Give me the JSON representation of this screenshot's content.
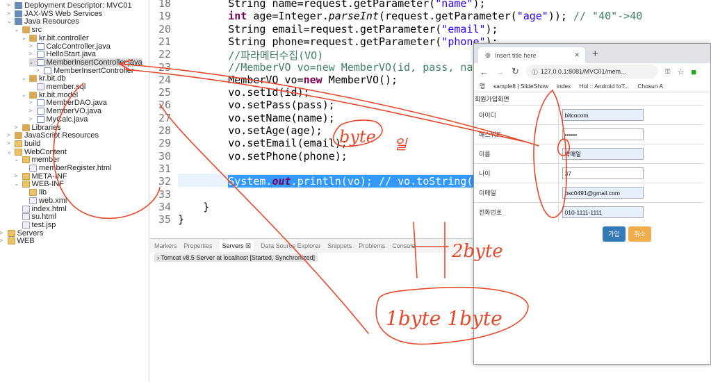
{
  "explorer": {
    "items": [
      {
        "label": "Deployment Descriptor: MVC01",
        "depth": 0,
        "arrow": ">",
        "icon": "proj"
      },
      {
        "label": "JAX-WS Web Services",
        "depth": 0,
        "arrow": ">",
        "icon": "proj"
      },
      {
        "label": "Java Resources",
        "depth": 0,
        "arrow": "v",
        "icon": "proj"
      },
      {
        "label": "src",
        "depth": 1,
        "arrow": "v",
        "icon": "pkg"
      },
      {
        "label": "kr.bit.controller",
        "depth": 2,
        "arrow": "v",
        "icon": "pkg"
      },
      {
        "label": "CalcController.java",
        "depth": 3,
        "arrow": ">",
        "icon": "java"
      },
      {
        "label": "HelloStart.java",
        "depth": 3,
        "arrow": ">",
        "icon": "java"
      },
      {
        "label": "MemberInsertController.java",
        "depth": 3,
        "arrow": "v",
        "icon": "java",
        "selected": true
      },
      {
        "label": "MemberInsertController",
        "depth": 4,
        "arrow": ">",
        "icon": "java"
      },
      {
        "label": "kr.bit.db",
        "depth": 2,
        "arrow": "v",
        "icon": "pkg"
      },
      {
        "label": "member.sql",
        "depth": 3,
        "arrow": "",
        "icon": "file"
      },
      {
        "label": "kr.bit.model",
        "depth": 2,
        "arrow": "v",
        "icon": "pkg"
      },
      {
        "label": "MemberDAO.java",
        "depth": 3,
        "arrow": ">",
        "icon": "java"
      },
      {
        "label": "MemberVO.java",
        "depth": 3,
        "arrow": ">",
        "icon": "java"
      },
      {
        "label": "MyCalc.java",
        "depth": 3,
        "arrow": ">",
        "icon": "java"
      },
      {
        "label": "Libraries",
        "depth": 1,
        "arrow": ">",
        "icon": "pkg"
      },
      {
        "label": "JavaScript Resources",
        "depth": 0,
        "arrow": ">",
        "icon": "pkg"
      },
      {
        "label": "build",
        "depth": 0,
        "arrow": ">",
        "icon": "folder"
      },
      {
        "label": "WebContent",
        "depth": 0,
        "arrow": "v",
        "icon": "folder"
      },
      {
        "label": "member",
        "depth": 1,
        "arrow": "v",
        "icon": "folder"
      },
      {
        "label": "memberRegister.html",
        "depth": 2,
        "arrow": "",
        "icon": "file"
      },
      {
        "label": "META-INF",
        "depth": 1,
        "arrow": ">",
        "icon": "folder"
      },
      {
        "label": "WEB-INF",
        "depth": 1,
        "arrow": "v",
        "icon": "folder"
      },
      {
        "label": "lib",
        "depth": 2,
        "arrow": "",
        "icon": "folder"
      },
      {
        "label": "web.xml",
        "depth": 2,
        "arrow": "",
        "icon": "file"
      },
      {
        "label": "index.html",
        "depth": 1,
        "arrow": "",
        "icon": "file"
      },
      {
        "label": "su.html",
        "depth": 1,
        "arrow": "",
        "icon": "file"
      },
      {
        "label": "test.jsp",
        "depth": 1,
        "arrow": "",
        "icon": "file"
      },
      {
        "label": "Servers",
        "depth": -1,
        "arrow": ">",
        "icon": "folder"
      },
      {
        "label": "WEB",
        "depth": -1,
        "arrow": ">",
        "icon": "folder"
      }
    ]
  },
  "editor": {
    "lines": [
      {
        "n": "18",
        "html": "        String name=request.getParameter(<s>\"name\"</s>);"
      },
      {
        "n": "19",
        "html": "        <k>int</k> age=Integer.<i>parseInt</i>(request.getParameter(<s>\"age\"</s>)); <c>// \"40\"->40</c>"
      },
      {
        "n": "20",
        "html": "        String email=request.getParameter(<s>\"email\"</s>);"
      },
      {
        "n": "21",
        "html": "        String phone=request.getParameter(<s>\"phone\"</s>);"
      },
      {
        "n": "22",
        "html": "        <c>//파라메터수집(VO)</c>"
      },
      {
        "n": "23",
        "html": "        <c>//MemberVO vo=new MemberVO(id, pass, name, age, email, phone);</c>"
      },
      {
        "n": "24",
        "html": "        MemberVO vo=<k>new</k> MemberVO();"
      },
      {
        "n": "25",
        "html": "        vo.setId(id);"
      },
      {
        "n": "26",
        "html": "        vo.setPass(pass);"
      },
      {
        "n": "27",
        "html": "        vo.setName(name);"
      },
      {
        "n": "28",
        "html": "        vo.setAge(age);"
      },
      {
        "n": "29",
        "html": "        vo.setEmail(email);"
      },
      {
        "n": "30",
        "html": "        vo.setPhone(phone);"
      },
      {
        "n": "31",
        "html": ""
      },
      {
        "n": "32",
        "html": "        <h>System.<b><i>out</i></b>.println(vo); // vo.toString()</h>"
      },
      {
        "n": "33",
        "html": ""
      },
      {
        "n": "34",
        "html": "    }"
      },
      {
        "n": "35",
        "html": "}"
      }
    ]
  },
  "panel": {
    "tabs": [
      "Markers",
      "Properties",
      "Servers ☒",
      "Data Source Explorer",
      "Snippets",
      "Problems",
      "Console"
    ],
    "active": 2,
    "server": "Tomcat v8.5 Server at localhost  [Started, Synchronized]"
  },
  "browser": {
    "tab_title": "Insert title here",
    "url": "127.0.0.1:8081/MVC01/mem...",
    "bookmarks": [
      "앱",
      "sample8 | SlideShow",
      "index",
      "Hol :: Android IoT...",
      "Chosun A"
    ],
    "form_title": "회원가입화면",
    "fields": [
      {
        "label": "아이디",
        "value": "bitcocom"
      },
      {
        "label": "패스워드",
        "value": "••••••"
      },
      {
        "label": "이름",
        "value": "박매일"
      },
      {
        "label": "나이",
        "value": "37"
      },
      {
        "label": "이메일",
        "value": "psc0491@gmail.com"
      },
      {
        "label": "전화번호",
        "value": "010-1111-1111"
      }
    ],
    "submit": "가입",
    "cancel": "취소"
  },
  "colors": {
    "ink": "#e8482a",
    "submit": "#337ab7",
    "cancel": "#f0ad4e"
  },
  "annotations": {
    "a1": "byte",
    "a2": "일",
    "a3": "박",
    "a4": "2byte",
    "a5": "1byte 1byte"
  }
}
